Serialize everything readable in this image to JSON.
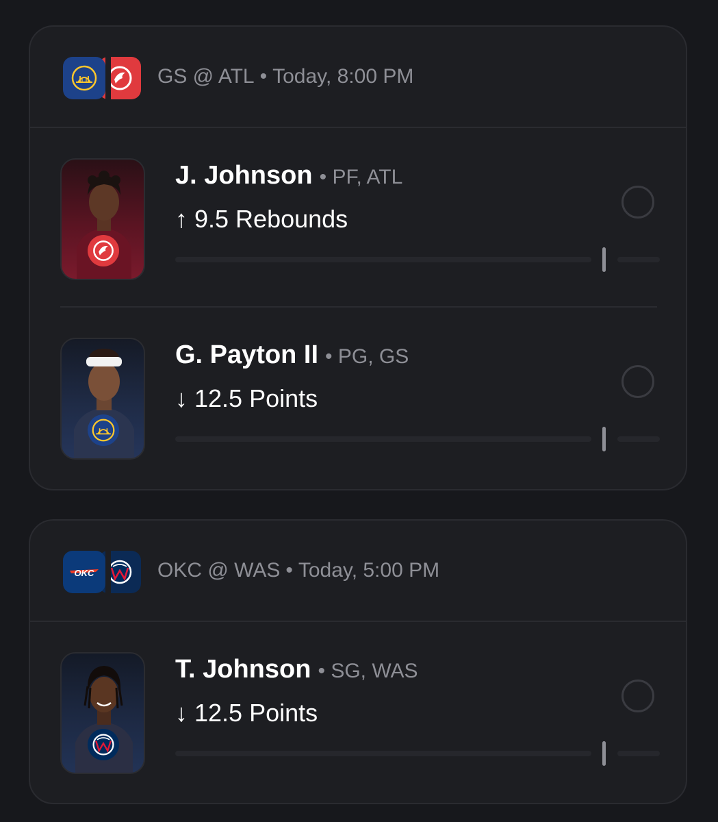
{
  "colors": {
    "background": "#17181c",
    "card": "#1d1e22",
    "muted_text": "#8e8f96",
    "gs_blue": "#1d428a",
    "gs_gold": "#ffc72c",
    "atl_red": "#e03a3e",
    "okc_blue": "#0b3a7a",
    "okc_orange": "#ef3b24",
    "was_navy": "#002b5c",
    "was_red": "#e31837"
  },
  "games": [
    {
      "away_logo_icon": "warriors-logo-icon",
      "home_logo_icon": "hawks-logo-icon",
      "matchup": "GS @ ATL",
      "separator": "•",
      "time": "Today, 8:00 PM",
      "props": [
        {
          "name": "J. Johnson",
          "separator": "•",
          "meta": "PF, ATL",
          "direction_icon": "arrow-up-icon",
          "arrow": "↑",
          "line": "9.5 Rebounds",
          "progress": 0
        },
        {
          "name": "G. Payton II",
          "separator": "•",
          "meta": "PG, GS",
          "direction_icon": "arrow-down-icon",
          "arrow": "↓",
          "line": "12.5 Points",
          "progress": 0
        }
      ]
    },
    {
      "away_logo_icon": "thunder-logo-icon",
      "home_logo_icon": "wizards-logo-icon",
      "matchup": "OKC @ WAS",
      "separator": "•",
      "time": "Today, 5:00 PM",
      "props": [
        {
          "name": "T. Johnson",
          "separator": "•",
          "meta": "SG, WAS",
          "direction_icon": "arrow-down-icon",
          "arrow": "↓",
          "line": "12.5 Points",
          "progress": 0
        }
      ]
    }
  ]
}
